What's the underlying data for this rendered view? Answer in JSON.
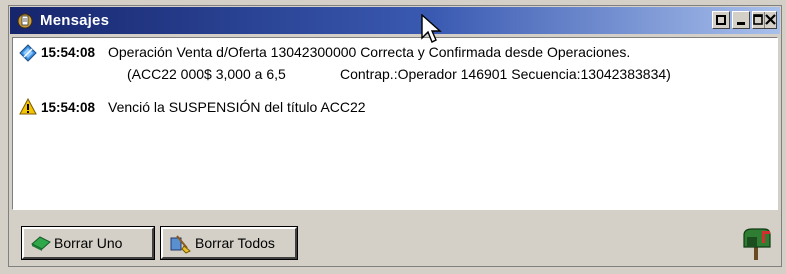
{
  "window": {
    "title": "Mensajes"
  },
  "messages": [
    {
      "icon": "info-diamond-icon",
      "time": "15:54:08",
      "line1": "Operación Venta d/Oferta 13042300000 Correcta y Confirmada desde Operaciones.",
      "line2_part1": "(ACC22    000$ 3,000 a 6,5",
      "line2_part2": "Contrap.:Operador 146901 Secuencia:13042383834)"
    },
    {
      "icon": "warning-icon",
      "time": "15:54:08",
      "line1": "Venció la SUSPENSIÓN del título ACC22"
    }
  ],
  "buttons": {
    "delete_one": "Borrar Uno",
    "delete_all": "Borrar Todos"
  },
  "colors": {
    "title_start": "#16256c",
    "title_end": "#a9c0ec",
    "window_bg": "#d4d0c8"
  }
}
